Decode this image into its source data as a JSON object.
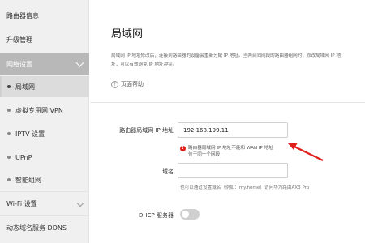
{
  "sidebar": {
    "items": [
      {
        "label": "路由器信息"
      },
      {
        "label": "升级管理"
      },
      {
        "label": "网络设置"
      },
      {
        "label": "局域网"
      },
      {
        "label": "虚拟专用网 VPN"
      },
      {
        "label": "IPTV 设置"
      },
      {
        "label": "UPnP"
      },
      {
        "label": "智能组网"
      },
      {
        "label": "Wi-Fi 设置"
      },
      {
        "label": "动态域名服务 DDNS"
      }
    ]
  },
  "main": {
    "title": "局域网",
    "desc_line1": "局域网 IP 地址修改后，连接到路由器的设备会重新分配 IP 地址。当两台同网段的路由器组网时，修改局域网 IP 地",
    "desc_line2": "址，可以有效避免 IP 地址冲突。",
    "help_label": "页面帮助",
    "ip_label": "路由器局域网 IP 地址",
    "ip_value": "192.168.199.11",
    "error_line1": "路由器局域网 IP 地址不能和 WAN IP 地址",
    "error_line2": "位于同一个网段",
    "domain_label": "域名",
    "domain_value": "",
    "domain_hint": "也可以通过设置域名（例如：my.home）访问华为路由AX3 Pro",
    "dhcp_label": "DHCP 服务器",
    "dhcp_enabled": false
  },
  "colors": {
    "accent_arrow": "#e0201c",
    "sidebar_active": "#b8b8b8"
  }
}
